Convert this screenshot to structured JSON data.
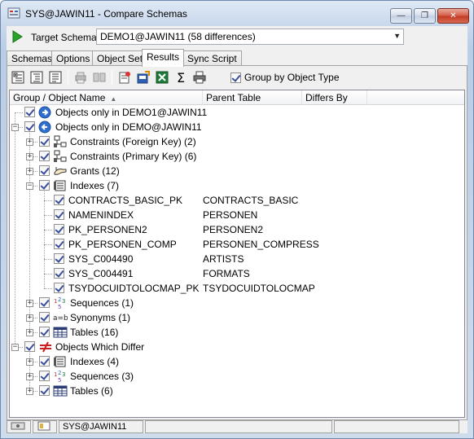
{
  "window": {
    "title": "SYS@JAWIN11 - Compare Schemas",
    "minimize": "—",
    "maximize": "❐",
    "close": "✕"
  },
  "target": {
    "label": "Target Schema:",
    "value": "DEMO1@JAWIN11 (58 differences)"
  },
  "tabs": [
    "Schemas",
    "Options",
    "Object Set",
    "Results",
    "Sync Script"
  ],
  "active_tab": "Results",
  "toolbar": {
    "group_by_label": "Group by Object Type",
    "group_by_checked": true
  },
  "grid": {
    "columns": [
      "Group / Object Name",
      "Parent Table",
      "Differs By"
    ],
    "rows": [
      {
        "label": "Objects only in DEMO1@JAWIN11",
        "parent": "",
        "level": 0,
        "expander": "",
        "icon": "arrow-right-icon"
      },
      {
        "label": "Objects only in DEMO@JAWIN11",
        "parent": "",
        "level": 0,
        "expander": "−",
        "icon": "arrow-left-icon"
      },
      {
        "label": "Constraints (Foreign Key) (2)",
        "parent": "",
        "level": 1,
        "expander": "+",
        "icon": "constraint-icon"
      },
      {
        "label": "Constraints (Primary Key) (6)",
        "parent": "",
        "level": 1,
        "expander": "+",
        "icon": "constraint-icon"
      },
      {
        "label": "Grants (12)",
        "parent": "",
        "level": 1,
        "expander": "+",
        "icon": "grant-icon"
      },
      {
        "label": "Indexes (7)",
        "parent": "",
        "level": 1,
        "expander": "−",
        "icon": "index-icon"
      },
      {
        "label": "CONTRACTS_BASIC_PK",
        "parent": "CONTRACTS_BASIC",
        "level": 2,
        "expander": "",
        "icon": ""
      },
      {
        "label": "NAMENINDEX",
        "parent": "PERSONEN",
        "level": 2,
        "expander": "",
        "icon": ""
      },
      {
        "label": "PK_PERSONEN2",
        "parent": "PERSONEN2",
        "level": 2,
        "expander": "",
        "icon": ""
      },
      {
        "label": "PK_PERSONEN_COMP",
        "parent": "PERSONEN_COMPRESS",
        "level": 2,
        "expander": "",
        "icon": ""
      },
      {
        "label": "SYS_C004490",
        "parent": "ARTISTS",
        "level": 2,
        "expander": "",
        "icon": ""
      },
      {
        "label": "SYS_C004491",
        "parent": "FORMATS",
        "level": 2,
        "expander": "",
        "icon": ""
      },
      {
        "label": "TSYDOCUIDTOLOCMAP_PK",
        "parent": "TSYDOCUIDTOLOCMAP",
        "level": 2,
        "expander": "",
        "icon": ""
      },
      {
        "label": "Sequences (1)",
        "parent": "",
        "level": 1,
        "expander": "+",
        "icon": "sequence-icon"
      },
      {
        "label": "Synonyms (1)",
        "parent": "",
        "level": 1,
        "expander": "+",
        "icon": "synonym-icon"
      },
      {
        "label": "Tables (16)",
        "parent": "",
        "level": 1,
        "expander": "+",
        "icon": "table-icon"
      },
      {
        "label": "Objects Which Differ",
        "parent": "",
        "level": 0,
        "expander": "−",
        "icon": "not-equal-icon"
      },
      {
        "label": "Indexes (4)",
        "parent": "",
        "level": 1,
        "expander": "+",
        "icon": "index-icon"
      },
      {
        "label": "Sequences (3)",
        "parent": "",
        "level": 1,
        "expander": "+",
        "icon": "sequence-icon"
      },
      {
        "label": "Tables (6)",
        "parent": "",
        "level": 1,
        "expander": "+",
        "icon": "table-icon"
      }
    ]
  },
  "statusbar": {
    "connection": "SYS@JAWIN11"
  },
  "colors": {
    "accent": "#3a4d9a",
    "run_green": "#2aa52a",
    "not_equal_red": "#d01c1c"
  }
}
